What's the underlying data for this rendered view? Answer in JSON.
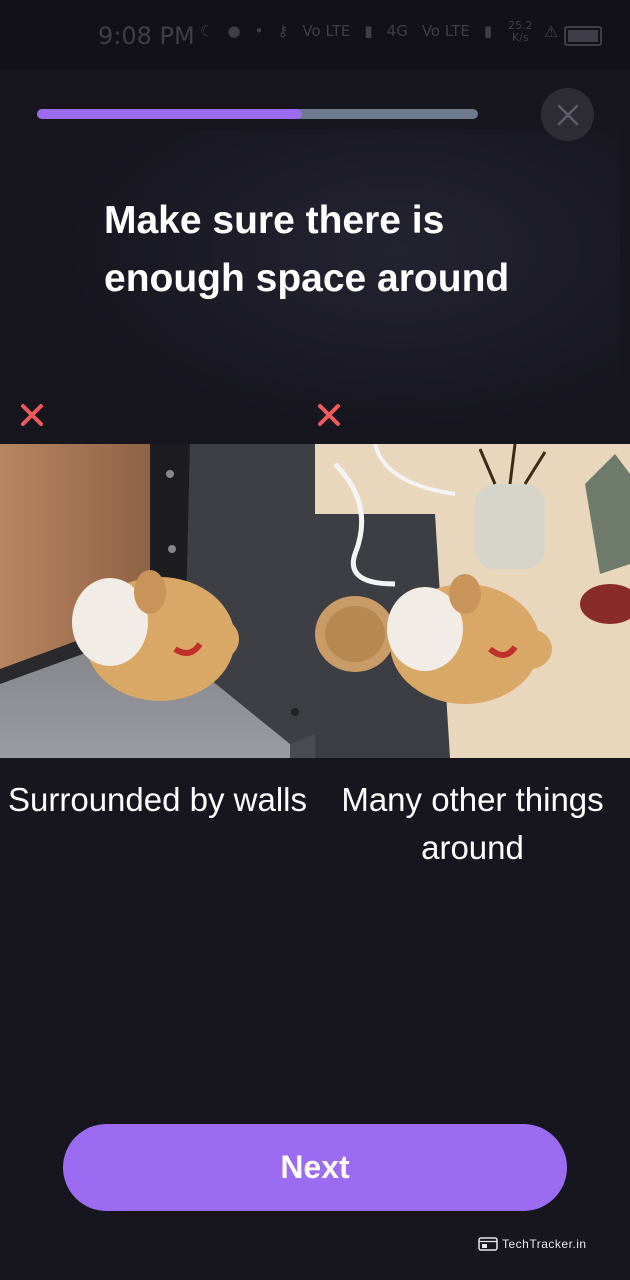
{
  "status_bar": {
    "time": "9:08 PM",
    "net_speed_value": "25.2",
    "net_speed_unit": "K/s",
    "signal_labels": [
      "Vo LTE",
      "4G",
      "Vo LTE"
    ]
  },
  "progress": {
    "fraction": 0.6
  },
  "headline": "Make sure there is enough space around",
  "examples": [
    {
      "caption": "Surrounded by walls",
      "mark": "x-icon"
    },
    {
      "caption": "Many other things around",
      "mark": "x-icon"
    }
  ],
  "next_button": {
    "label": "Next"
  },
  "watermark": "TechTracker.in",
  "colors": {
    "accent": "#9b6bf2",
    "progress_track": "#6d7a8e",
    "background": "#17161f",
    "error_x": "#f05a5a"
  }
}
